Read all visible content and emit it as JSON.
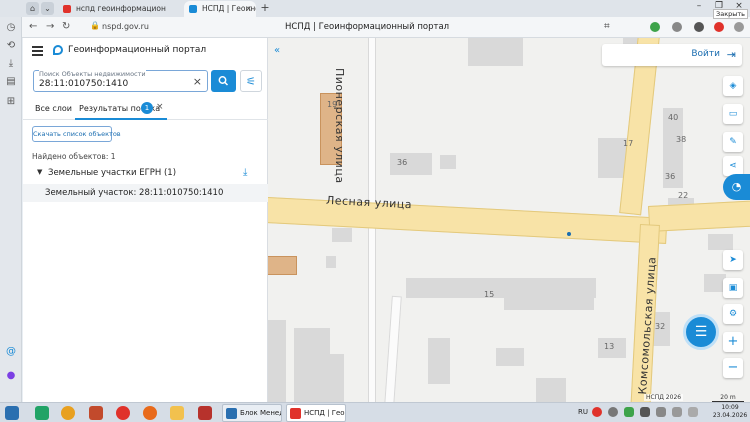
{
  "browser": {
    "tabs": [
      {
        "label": "нспд геоинформацион"
      },
      {
        "label": "НСПД | Геоинформацио"
      }
    ],
    "url": "nspd.gov.ru",
    "page_title": "НСПД | Геоинформационный портал",
    "close_tooltip": "Закрыть"
  },
  "panel": {
    "portal_name": "Геоинформационный портал",
    "search": {
      "label": "Поиск Объекты недвижимости",
      "value": "28:11:010750:1410"
    },
    "tabs": {
      "all_layers": "Все слои",
      "results": "Результаты поиска",
      "results_count": "1"
    },
    "download_list": "Скачать список объектов",
    "found_count": "Найдено объектов: 1",
    "group_label": "Земельные участки ЕГРН (1)",
    "result_item": "Земельный участок: 28:11:010750:1410"
  },
  "map": {
    "login": "Войти",
    "streets": {
      "pionerskaya": "Пионерская улица",
      "lesnaya": "Лесная улица",
      "komsomolskaya": "Комсомольская улица"
    },
    "house_numbers": [
      "19",
      "36",
      "17",
      "38",
      "40",
      "36",
      "22",
      "15",
      "13",
      "32"
    ],
    "attribution": "НСПД 2026",
    "scale": "20 m"
  },
  "taskbar": {
    "apps": [
      {
        "label": "Блок Менеджм..."
      },
      {
        "label": "НСПД | Геоин..."
      }
    ],
    "lang": "RU",
    "time": "10:09",
    "date": "23.04.2026"
  }
}
